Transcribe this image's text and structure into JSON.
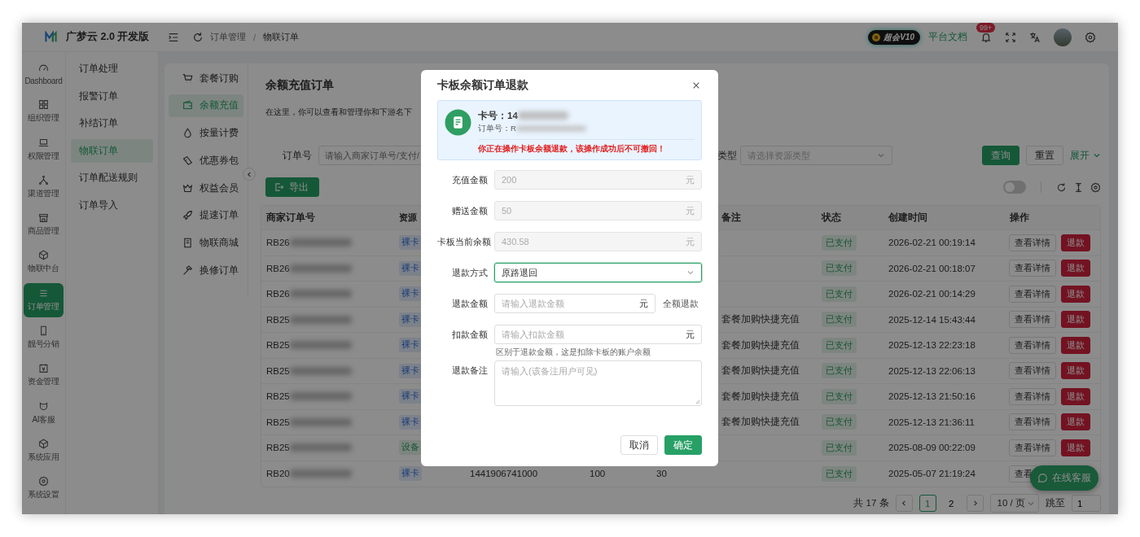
{
  "header": {
    "logo_text": "广梦云 2.0 开发版",
    "breadcrumb": [
      "订单管理",
      "物联订单"
    ],
    "breadcrumb_separator": "/",
    "vip_badge": "超会V10",
    "docs_link": "平台文档",
    "notification_count": "99+"
  },
  "rail": [
    {
      "label": "Dashboard",
      "selected": false
    },
    {
      "label": "组织管理",
      "selected": false
    },
    {
      "label": "权限管理",
      "selected": false
    },
    {
      "label": "渠道管理",
      "selected": false
    },
    {
      "label": "商品管理",
      "selected": false
    },
    {
      "label": "物联中台",
      "selected": false
    },
    {
      "label": "订单管理",
      "selected": true
    },
    {
      "label": "靓号分销",
      "selected": false
    },
    {
      "label": "资金管理",
      "selected": false
    },
    {
      "label": "AI客服",
      "selected": false
    },
    {
      "label": "系统应用",
      "selected": false
    },
    {
      "label": "系统设置",
      "selected": false
    }
  ],
  "submenu": [
    {
      "label": "订单处理",
      "selected": false
    },
    {
      "label": "报警订单",
      "selected": false
    },
    {
      "label": "补结订单",
      "selected": false
    },
    {
      "label": "物联订单",
      "selected": true
    },
    {
      "label": "订单配送规则",
      "selected": false
    },
    {
      "label": "订单导入",
      "selected": false
    }
  ],
  "inner_menu": [
    {
      "label": "套餐订购",
      "selected": false
    },
    {
      "label": "余额充值",
      "selected": true
    },
    {
      "label": "按量计费",
      "selected": false
    },
    {
      "label": "优惠券包",
      "selected": false
    },
    {
      "label": "权益会员",
      "selected": false
    },
    {
      "label": "提速订单",
      "selected": false
    },
    {
      "label": "物联商城",
      "selected": false
    },
    {
      "label": "换修订单",
      "selected": false
    }
  ],
  "page": {
    "title": "余额充值订单",
    "description": "在这里，你可以查看和管理你和下游名下",
    "filters": {
      "order_label": "订单号",
      "order_placeholder": "请输入商家订单号/支付/",
      "type_label": "类型",
      "type_placeholder": "请选择资源类型",
      "query": "查询",
      "reset": "重置",
      "expand": "展开"
    },
    "export": "导出",
    "auto_refresh": {
      "on": false
    }
  },
  "table": {
    "columns": [
      {
        "label": "商家订单号"
      },
      {
        "label": "资源"
      },
      {},
      {},
      {},
      {
        "label": "备注"
      },
      {
        "label": "状态"
      },
      {
        "label": "创建时间"
      },
      {
        "label": "操作"
      }
    ],
    "rows": [
      {
        "order_prefix": "RB26",
        "resource": {
          "text": "裸卡",
          "kind": "card"
        },
        "status": "已支付",
        "created": "2026-02-21 00:19:14",
        "actions": [
          {
            "label": "查看详情",
            "kind": "default"
          },
          {
            "label": "退款",
            "kind": "danger"
          }
        ]
      },
      {
        "order_prefix": "RB26",
        "resource": {
          "text": "裸卡",
          "kind": "card"
        },
        "status": "已支付",
        "created": "2026-02-21 00:18:07",
        "actions": [
          {
            "label": "查看详情",
            "kind": "default"
          },
          {
            "label": "退款",
            "kind": "danger"
          }
        ]
      },
      {
        "order_prefix": "RB26",
        "resource": {
          "text": "裸卡",
          "kind": "card"
        },
        "status": "已支付",
        "created": "2026-02-21 00:14:29",
        "actions": [
          {
            "label": "查看详情",
            "kind": "default"
          },
          {
            "label": "退款",
            "kind": "danger"
          }
        ]
      },
      {
        "order_prefix": "RB25",
        "resource": {
          "text": "裸卡",
          "kind": "card"
        },
        "remark": "套餐加购快捷充值",
        "status": "已支付",
        "created": "2025-12-14 15:43:44",
        "actions": [
          {
            "label": "查看详情",
            "kind": "default"
          },
          {
            "label": "退款",
            "kind": "danger"
          }
        ]
      },
      {
        "order_prefix": "RB25",
        "resource": {
          "text": "裸卡",
          "kind": "card"
        },
        "remark": "套餐加购快捷充值",
        "status": "已支付",
        "created": "2025-12-13 22:23:18",
        "actions": [
          {
            "label": "查看详情",
            "kind": "default"
          },
          {
            "label": "退款",
            "kind": "danger"
          }
        ]
      },
      {
        "order_prefix": "RB25",
        "resource": {
          "text": "裸卡",
          "kind": "card"
        },
        "remark": "套餐加购快捷充值",
        "status": "已支付",
        "created": "2025-12-13 22:06:13",
        "actions": [
          {
            "label": "查看详情",
            "kind": "default"
          },
          {
            "label": "退款",
            "kind": "danger"
          }
        ]
      },
      {
        "order_prefix": "RB25",
        "resource": {
          "text": "裸卡",
          "kind": "card"
        },
        "remark": "套餐加购快捷充值",
        "status": "已支付",
        "created": "2025-12-13 21:50:16",
        "actions": [
          {
            "label": "查看详情",
            "kind": "default"
          },
          {
            "label": "退款",
            "kind": "danger"
          }
        ]
      },
      {
        "order_prefix": "RB25",
        "resource": {
          "text": "裸卡",
          "kind": "card"
        },
        "remark": "套餐加购快捷充值",
        "status": "已支付",
        "created": "2025-12-13 21:36:11",
        "actions": [
          {
            "label": "查看详情",
            "kind": "default"
          },
          {
            "label": "退款",
            "kind": "danger"
          }
        ]
      },
      {
        "order_prefix": "RB25",
        "resource": {
          "text": "设备",
          "kind": "device"
        },
        "status": "已支付",
        "created": "2025-08-09 00:22:09",
        "actions": [
          {
            "label": "查看详情",
            "kind": "default"
          },
          {
            "label": "退款",
            "kind": "danger"
          }
        ]
      },
      {
        "order_prefix": "RB20",
        "resource": {
          "text": "裸卡",
          "kind": "card"
        },
        "column_3": "1441906741000",
        "column_4": "100",
        "column_5": "30",
        "status": "已支付",
        "created": "2025-05-07 21:19:24",
        "actions": [
          {
            "label": "查看",
            "kind": "default"
          }
        ]
      }
    ]
  },
  "pagination": {
    "total": "共 17 条",
    "pages": [
      {
        "label": "1",
        "selected": true
      },
      {
        "label": "2",
        "selected": false
      }
    ],
    "page_size": "10 / 页",
    "jump_label": "跳至",
    "jump_value": "1"
  },
  "chat_button": "在线客服",
  "modal": {
    "title": "卡板余额订单退款",
    "card_label": "卡号：14",
    "order_label": "订单号：R",
    "warning": "你正在操作卡板余额退款，该操作成功后不可撤回！",
    "fields": [
      {
        "kind": "readonly",
        "label": "充值金额",
        "value": "200",
        "suffix": "元"
      },
      {
        "kind": "readonly",
        "label": "赠送金额",
        "value": "50",
        "suffix": "元"
      },
      {
        "kind": "readonly",
        "label": "卡板当前余额",
        "value": "430.58",
        "suffix": "元"
      },
      {
        "kind": "select",
        "label": "退款方式",
        "value": "原路退回",
        "focused": true
      },
      {
        "kind": "amount",
        "label": "退款金额",
        "placeholder": "请输入退款金额",
        "suffix": "元",
        "action": "全额退款"
      },
      {
        "kind": "amount",
        "label": "扣款金额",
        "placeholder": "请输入扣款金额",
        "suffix": "元",
        "hint": "区别于退款金额，这是扣除卡板的账户余额"
      },
      {
        "kind": "textarea",
        "label": "退款备注",
        "placeholder": "请输入(该备注用户可见)"
      }
    ],
    "cancel": "取消",
    "confirm": "确定"
  }
}
